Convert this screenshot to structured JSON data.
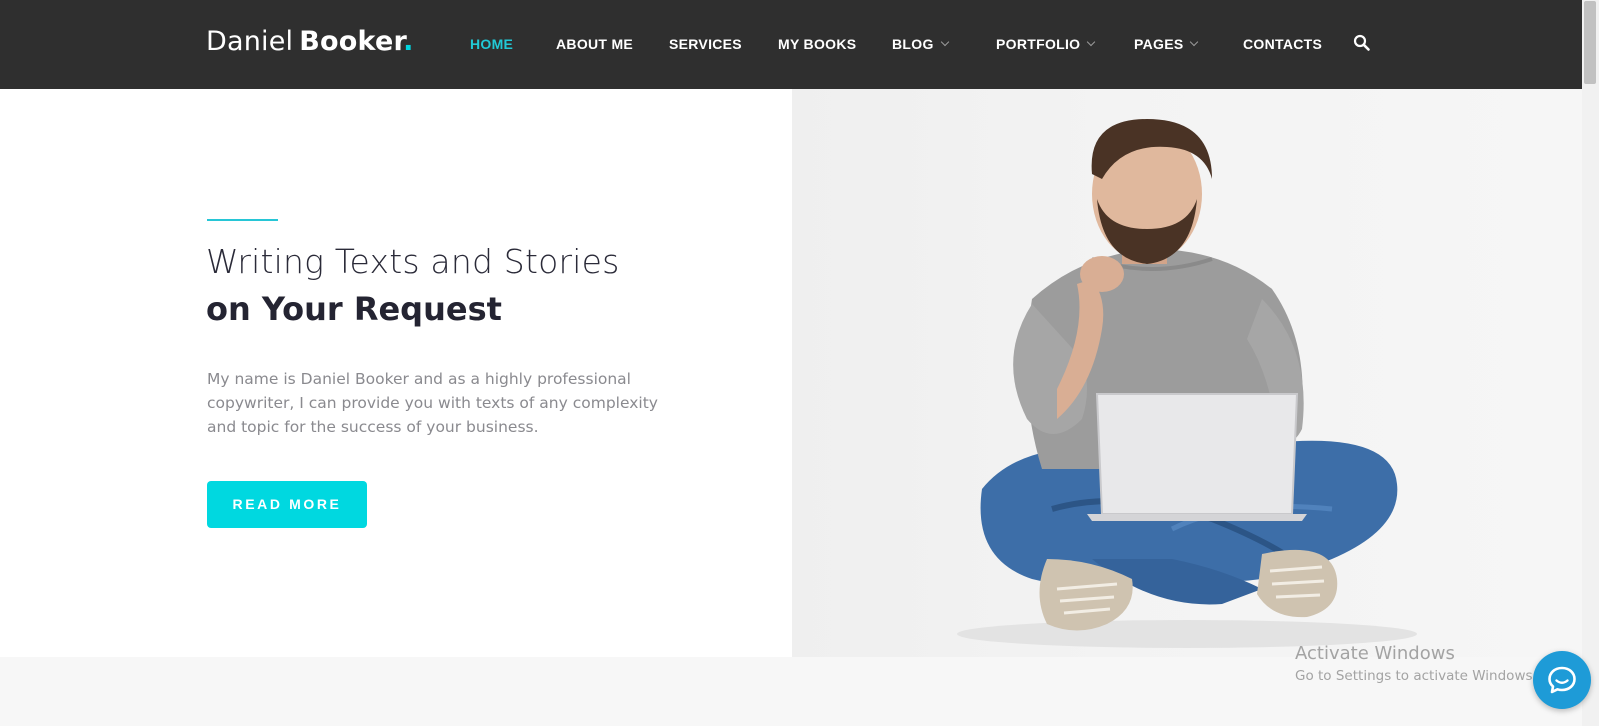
{
  "logo": {
    "first": "Daniel",
    "last": "Booker",
    "dot": "."
  },
  "nav": {
    "home": "HOME",
    "about": "ABOUT ME",
    "services": "SERVICES",
    "books": "MY BOOKS",
    "blog": "BLOG",
    "portfolio": "PORTFOLIO",
    "pages": "PAGES",
    "contacts": "CONTACTS"
  },
  "hero": {
    "headline_line1": "Writing Texts and Stories",
    "headline_line2": "on Your Request",
    "intro": "My name is Daniel Booker and as a highly professional copywriter, I can provide you with texts of any complexity and topic for the success of your business.",
    "cta": "READ MORE"
  },
  "watermark": {
    "title": "Activate Windows",
    "subtitle": "Go to Settings to activate Windows."
  },
  "colors": {
    "header_bg": "#2f2f2f",
    "accent": "#00d8e0",
    "active_nav": "#21c9d6",
    "chat": "#1e9bd7"
  },
  "icons": {
    "search": "search-icon",
    "dropdown": "chevron-down-icon",
    "chat": "chat-bubble-icon"
  }
}
